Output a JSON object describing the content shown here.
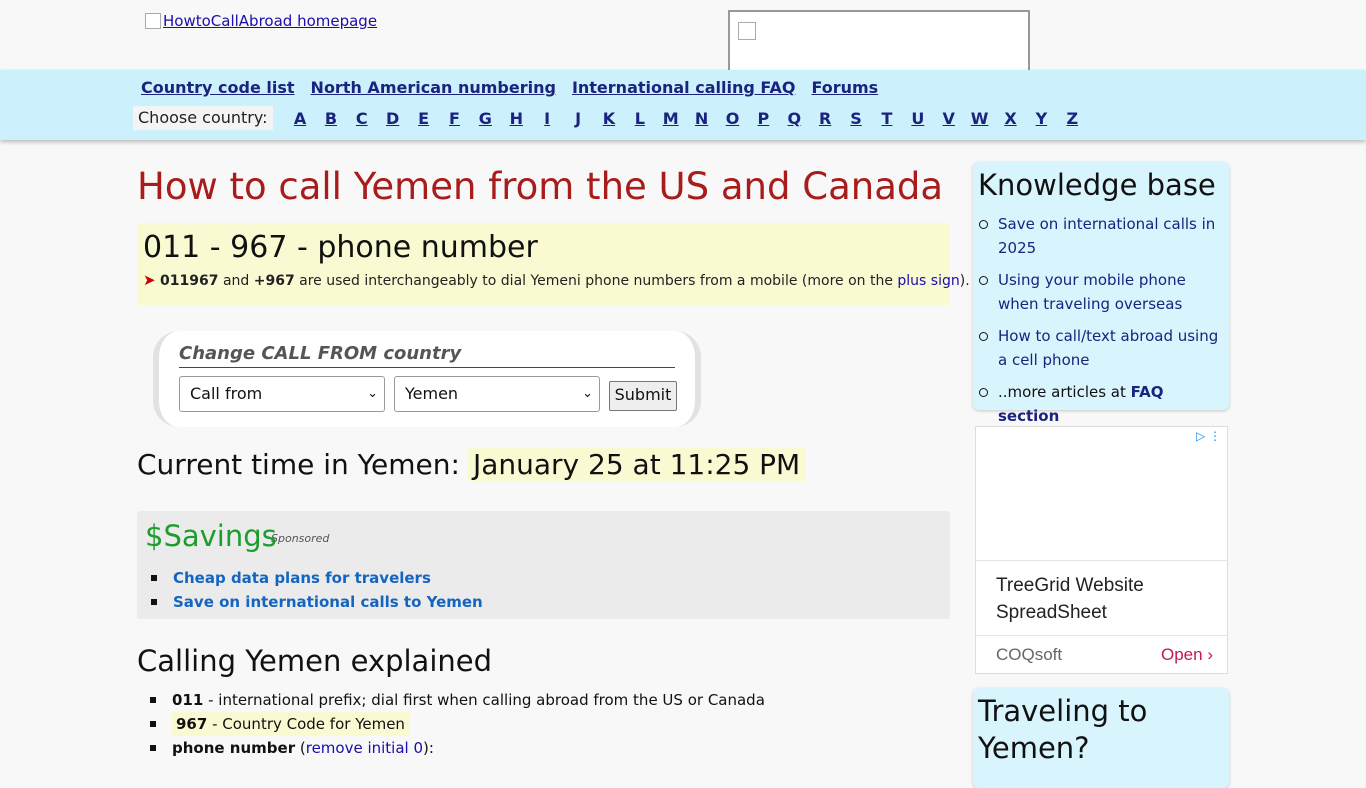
{
  "header": {
    "logo_alt": "HowtoCallAbroad homepage"
  },
  "nav": {
    "links": [
      "Country code list",
      "North American numbering",
      "International calling FAQ",
      "Forums"
    ],
    "choose_label": "Choose country:",
    "letters": [
      "A",
      "B",
      "C",
      "D",
      "E",
      "F",
      "G",
      "H",
      "I",
      "J",
      "K",
      "L",
      "M",
      "N",
      "O",
      "P",
      "Q",
      "R",
      "S",
      "T",
      "U",
      "V",
      "W",
      "X",
      "Y",
      "Z"
    ]
  },
  "main": {
    "title": "How to call Yemen from the US and Canada",
    "dial_format": "011 - 967 - phone number",
    "note": {
      "code1": "011967",
      "and": "and",
      "code2": "+967",
      "text": "are used interchangeably to dial Yemeni phone numbers from a mobile (more on the",
      "link": "plus sign",
      "end": ")."
    },
    "form": {
      "title": "Change CALL FROM country",
      "from_value": "Call from",
      "to_value": "Yemen",
      "submit": "Submit"
    },
    "time": {
      "label": "Current time in Yemen:",
      "value": "January 25 at 11:25 PM"
    },
    "savings": {
      "title": "$Savings",
      "sponsored": "Sponsored",
      "links": [
        "Cheap data plans for travelers",
        "Save on international calls to Yemen"
      ]
    },
    "explained": {
      "title": "Calling Yemen explained",
      "prefix_code": "011",
      "prefix_text": "- international prefix; dial first when calling abroad from the US or Canada",
      "country_code": "967",
      "country_text": "- Country Code for Yemen",
      "phone_label": "phone number",
      "phone_open": "(",
      "phone_link": "remove initial 0",
      "phone_close": "):"
    }
  },
  "sidebar": {
    "kb_title": "Knowledge base",
    "articles": [
      "Save on international calls in 2025",
      "Using your mobile phone when traveling overseas",
      "How to call/text abroad using a cell phone"
    ],
    "more_text": "..more articles at",
    "more_link": "FAQ section",
    "ad": {
      "title": "TreeGrid Website SpreadSheet",
      "advertiser": "COQsoft",
      "cta": "Open"
    },
    "travel_title": "Traveling to Yemen?"
  },
  "colors": {
    "nav_bg": "#ccf0fc",
    "title_red": "#a81c1c",
    "highlight": "#fafad2",
    "savings_green": "#1b9e2e",
    "sidebar_bg": "#d8f4fd"
  }
}
